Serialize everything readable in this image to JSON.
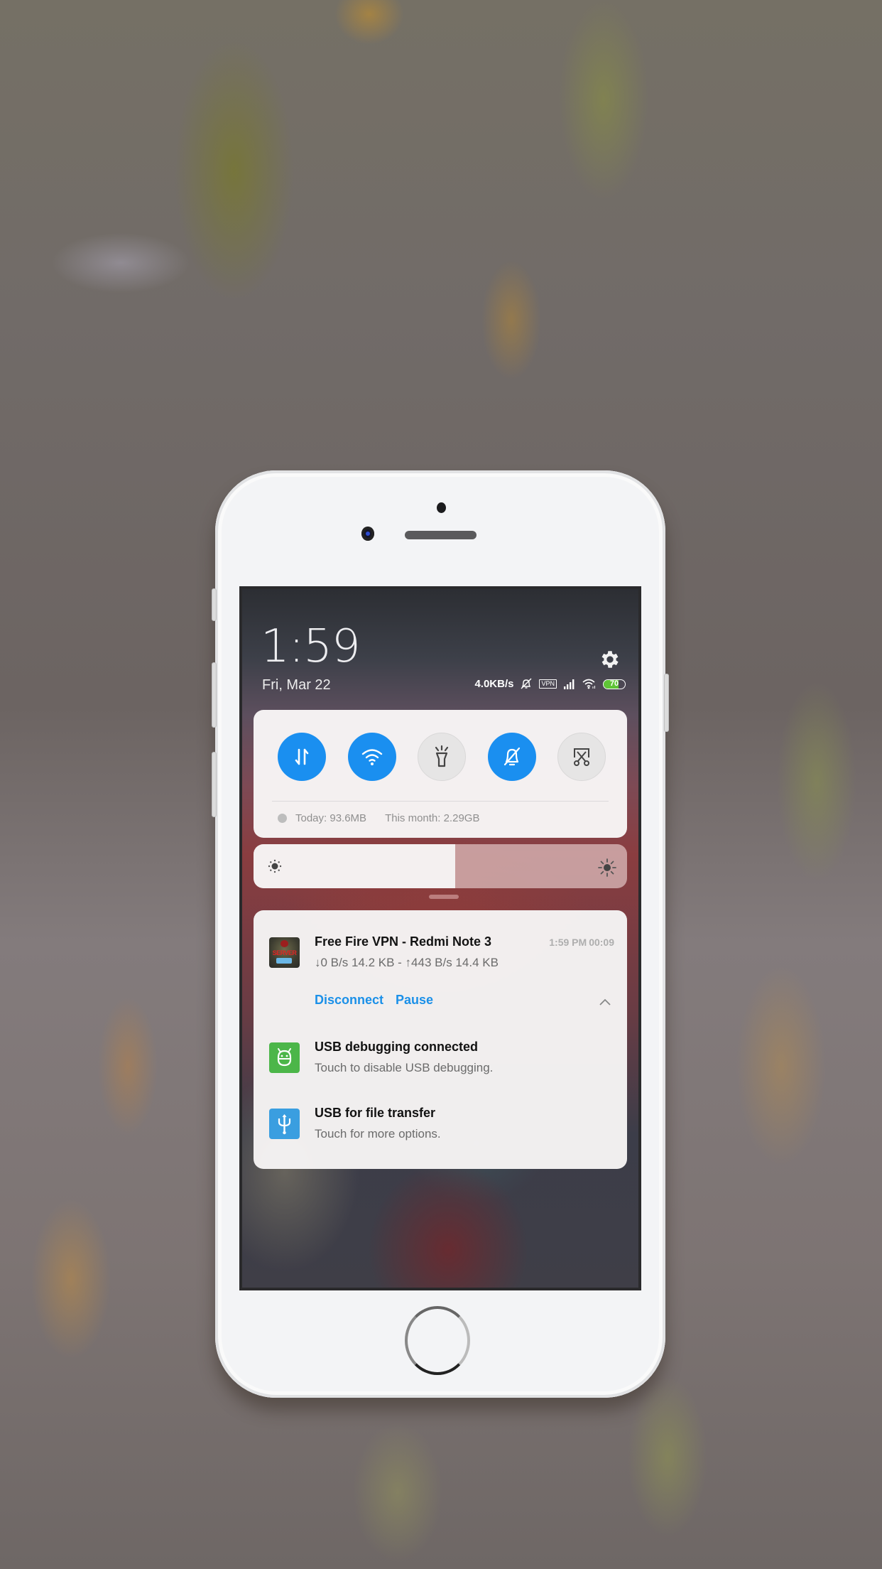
{
  "device": {
    "model": "white smartphone mockup"
  },
  "status_bar": {
    "time": "1:59",
    "date": "Fri, Mar 22",
    "network_speed": "4.0KB/s",
    "vpn_badge": "VPN",
    "battery_percent": 70,
    "battery_label": "70",
    "icons": [
      "bell-off-icon",
      "vpn-icon",
      "signal-icon",
      "wifi-icon",
      "battery-icon"
    ]
  },
  "settings": {
    "icon": "gear-icon"
  },
  "quick_toggles": [
    {
      "name": "mobile-data",
      "icon": "data-arrows-icon",
      "state": "on"
    },
    {
      "name": "wifi",
      "icon": "wifi-icon",
      "state": "on"
    },
    {
      "name": "flashlight",
      "icon": "flashlight-icon",
      "state": "off"
    },
    {
      "name": "silent",
      "icon": "bell-off-icon",
      "state": "on"
    },
    {
      "name": "screenshot",
      "icon": "scissors-screenshot-icon",
      "state": "off"
    }
  ],
  "data_usage": {
    "today": "Today: 93.6MB",
    "month": "This month: 2.29GB"
  },
  "brightness": {
    "level_percent": 54
  },
  "notifications": [
    {
      "app": "Free Fire VPN",
      "icon": "vpn-app-icon",
      "icon_text": "SERVER",
      "title": "Free Fire VPN - Redmi Note 3",
      "text": "↓0 B/s 14.2 KB - ↑443 B/s 14.4 KB",
      "time": "1:59 PM",
      "duration": "00:09",
      "actions": [
        "Disconnect",
        "Pause"
      ],
      "expanded": true
    },
    {
      "icon": "android-debug-icon",
      "title": "USB debugging connected",
      "text": "Touch to disable USB debugging."
    },
    {
      "icon": "usb-icon",
      "title": "USB for file transfer",
      "text": "Touch for more options."
    }
  ],
  "colors": {
    "accent": "#1a8ff0",
    "toggle_off": "#e6e5e5",
    "debug_icon_bg": "#4cb649",
    "usb_icon_bg": "#3a9ee0",
    "battery_fill": "#5fc436"
  }
}
